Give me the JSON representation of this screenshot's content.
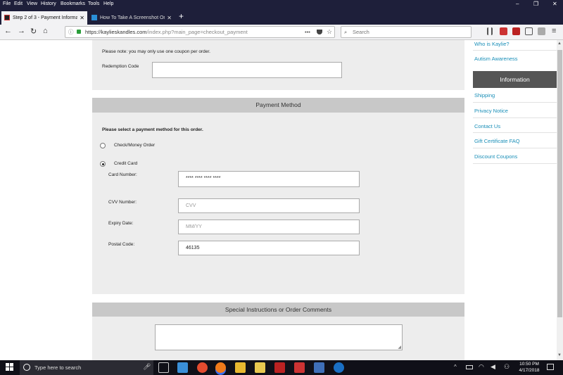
{
  "menubar": {
    "items": [
      "File",
      "Edit",
      "View",
      "History",
      "Bookmarks",
      "Tools",
      "Help"
    ],
    "controls": [
      "–",
      "❐",
      "✕"
    ]
  },
  "tabs": [
    {
      "title": "Step 2 of 3 - Payment Informati",
      "active": true
    },
    {
      "title": "How To Take A Screenshot On",
      "active": false
    }
  ],
  "new_tab_label": "+",
  "navbar": {
    "url_domain": "https://kaylieskandles.com",
    "url_path": "/index.php?main_page=checkout_payment",
    "search_placeholder": "Search",
    "page_actions": "•••"
  },
  "coupon": {
    "note": "Please note: you may only use one coupon per order.",
    "redemption_label": "Redemption Code",
    "redemption_value": ""
  },
  "payment": {
    "header": "Payment Method",
    "instruction": "Please select a payment method for this order.",
    "methods": [
      {
        "label": "Check/Money Order",
        "selected": false
      },
      {
        "label": "Credit Card",
        "selected": true
      }
    ],
    "card_number_label": "Card Number:",
    "card_number_value": "**** **** **** ****",
    "cvv_label": "CVV Number:",
    "cvv_placeholder": "CVV",
    "expiry_label": "Expiry Date:",
    "expiry_placeholder": "MM/YY",
    "postal_label": "Postal Code:",
    "postal_value": "46135"
  },
  "comments": {
    "header": "Special Instructions or Order Comments"
  },
  "sidebar": {
    "top_links": [
      "Who is Kaylie?",
      "Autism Awareness"
    ],
    "information_header": "Information",
    "information_links": [
      "Shipping",
      "Privacy Notice",
      "Contact Us",
      "Gift Certificate FAQ",
      "Discount Coupons"
    ]
  },
  "taskbar": {
    "search_placeholder": "Type here to search",
    "time": "10:50 PM",
    "date": "4/17/2018"
  },
  "colors": {
    "link": "#1a8fb8",
    "panel": "#ededed",
    "header": "#c8c8c8",
    "sidebar_header": "#555555",
    "titlebar": "#1e1f3a"
  }
}
